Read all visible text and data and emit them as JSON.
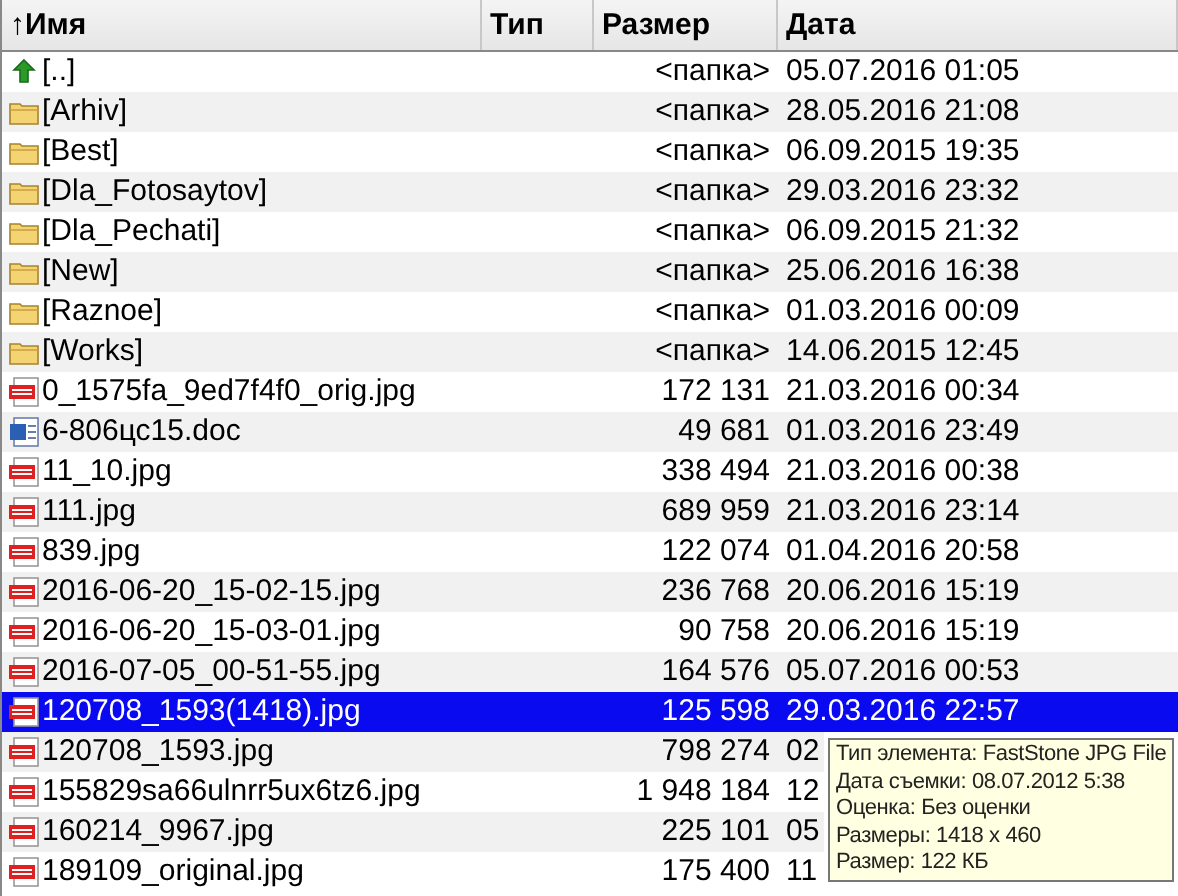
{
  "columns": [
    {
      "label": "Имя",
      "sort_icon": "↑"
    },
    {
      "label": "Тип"
    },
    {
      "label": "Размер"
    },
    {
      "label": "Дата"
    }
  ],
  "rows": [
    {
      "kind": "up",
      "name": "[..]",
      "size": "<папка>",
      "date": "05.07.2016 01:05",
      "selected": false
    },
    {
      "kind": "folder",
      "name": "[Arhiv]",
      "size": "<папка>",
      "date": "28.05.2016 21:08",
      "selected": false
    },
    {
      "kind": "folder",
      "name": "[Best]",
      "size": "<папка>",
      "date": "06.09.2015 19:35",
      "selected": false
    },
    {
      "kind": "folder",
      "name": "[Dla_Fotosaytov]",
      "size": "<папка>",
      "date": "29.03.2016 23:32",
      "selected": false
    },
    {
      "kind": "folder",
      "name": "[Dla_Pechati]",
      "size": "<папка>",
      "date": "06.09.2015 21:32",
      "selected": false
    },
    {
      "kind": "folder",
      "name": "[New]",
      "size": "<папка>",
      "date": "25.06.2016 16:38",
      "selected": false
    },
    {
      "kind": "folder",
      "name": "[Raznoe]",
      "size": "<папка>",
      "date": "01.03.2016 00:09",
      "selected": false
    },
    {
      "kind": "folder",
      "name": "[Works]",
      "size": "<папка>",
      "date": "14.06.2015 12:45",
      "selected": false
    },
    {
      "kind": "jpg",
      "name": "0_1575fa_9ed7f4f0_orig.jpg",
      "size": "172 131",
      "date": "21.03.2016 00:34",
      "selected": false
    },
    {
      "kind": "doc",
      "name": "6-806цс15.doc",
      "size": "49 681",
      "date": "01.03.2016 23:49",
      "selected": false
    },
    {
      "kind": "jpg",
      "name": "11_10.jpg",
      "size": "338 494",
      "date": "21.03.2016 00:38",
      "selected": false
    },
    {
      "kind": "jpg",
      "name": "111.jpg",
      "size": "689 959",
      "date": "21.03.2016 23:14",
      "selected": false
    },
    {
      "kind": "jpg",
      "name": "839.jpg",
      "size": "122 074",
      "date": "01.04.2016 20:58",
      "selected": false
    },
    {
      "kind": "jpg",
      "name": "2016-06-20_15-02-15.jpg",
      "size": "236 768",
      "date": "20.06.2016 15:19",
      "selected": false
    },
    {
      "kind": "jpg",
      "name": "2016-06-20_15-03-01.jpg",
      "size": "90 758",
      "date": "20.06.2016 15:19",
      "selected": false
    },
    {
      "kind": "jpg",
      "name": "2016-07-05_00-51-55.jpg",
      "size": "164 576",
      "date": "05.07.2016 00:53",
      "selected": false
    },
    {
      "kind": "jpg",
      "name": "120708_1593(1418).jpg",
      "size": "125 598",
      "date": "29.03.2016 22:57",
      "selected": true
    },
    {
      "kind": "jpg",
      "name": "120708_1593.jpg",
      "size": "798 274",
      "date": "02",
      "selected": false
    },
    {
      "kind": "jpg",
      "name": "155829sa66ulnrr5ux6tz6.jpg",
      "size": "1 948 184",
      "date": "12",
      "selected": false
    },
    {
      "kind": "jpg",
      "name": "160214_9967.jpg",
      "size": "225 101",
      "date": "05",
      "selected": false
    },
    {
      "kind": "jpg",
      "name": "189109_original.jpg",
      "size": "175 400",
      "date": "11",
      "selected": false
    }
  ],
  "tooltip": [
    "Тип элемента: FastStone JPG File",
    "Дата съемки: 08.07.2012 5:38",
    "Оценка: Без оценки",
    "Размеры: 1418 x 460",
    "Размер: 122 КБ"
  ]
}
